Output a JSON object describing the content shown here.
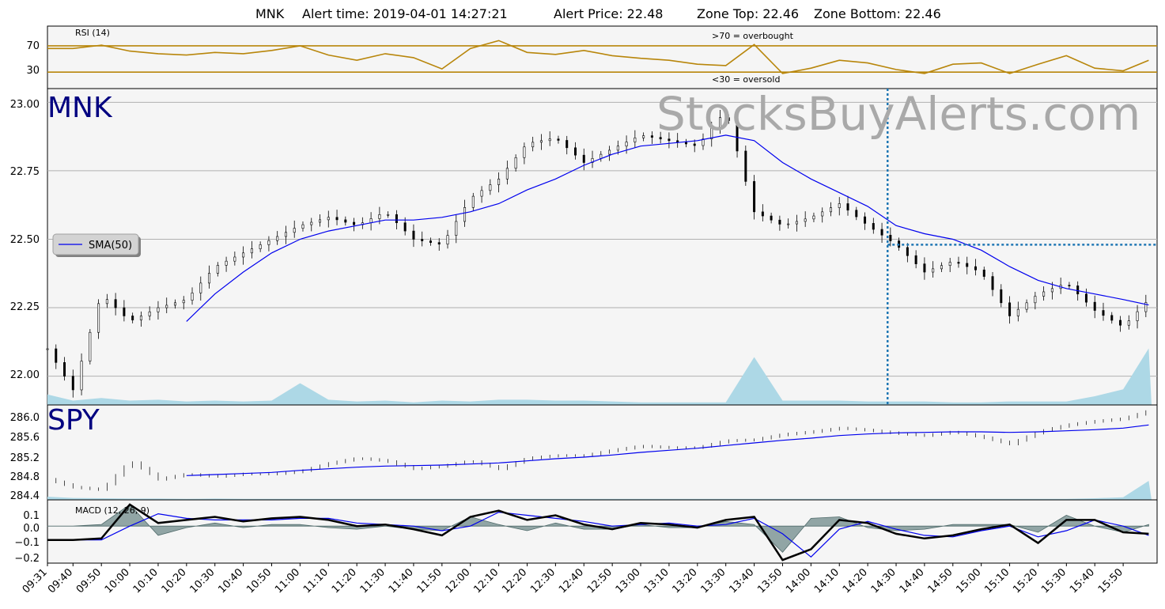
{
  "header": {
    "symbol": "MNK",
    "alert_time_label": "Alert time: 2019-04-01 14:27:21",
    "alert_price_label": "Alert Price: 22.48",
    "zone_top_label": "Zone Top: 22.46",
    "zone_bottom_label": "Zone Bottom: 22.46"
  },
  "watermark": "StocksBuyAlerts.com",
  "colors": {
    "rsi_line": "#b8860b",
    "sma": "#0000ee",
    "volume": "#add8e6",
    "alert_line": "#1f77b4",
    "macd_hist": "#6f8a8a",
    "panel_bg": "#f5f5f5",
    "label_navy": "#000080"
  },
  "chart_data": [
    {
      "type": "line",
      "name": "rsi_panel",
      "title": "RSI (14)",
      "annotations": [
        ">70 = overbought",
        "<30 = oversold"
      ],
      "yticks": [
        "70",
        "30"
      ],
      "ylim": [
        5,
        100
      ],
      "thresholds": [
        70,
        30
      ],
      "x": [
        "09:31",
        "09:40",
        "09:50",
        "10:00",
        "10:10",
        "10:20",
        "10:30",
        "10:40",
        "10:50",
        "11:00",
        "11:10",
        "11:20",
        "11:30",
        "11:40",
        "11:50",
        "12:00",
        "12:10",
        "12:20",
        "12:30",
        "12:40",
        "12:50",
        "13:00",
        "13:10",
        "13:20",
        "13:30",
        "13:40",
        "13:50",
        "14:00",
        "14:10",
        "14:20",
        "14:30",
        "14:40",
        "14:50",
        "15:00",
        "15:10",
        "15:20",
        "15:30",
        "15:40",
        "15:50",
        "15:59"
      ],
      "values": [
        66,
        66,
        71,
        62,
        58,
        56,
        60,
        58,
        63,
        70,
        56,
        48,
        58,
        52,
        35,
        66,
        78,
        60,
        57,
        63,
        55,
        51,
        48,
        42,
        40,
        72,
        28,
        36,
        48,
        44,
        34,
        28,
        42,
        44,
        28,
        42,
        55,
        36,
        32,
        48
      ]
    },
    {
      "type": "candlestick",
      "name": "mnk_price",
      "label": "MNK",
      "legend": "SMA(50)",
      "yticks": [
        "23.00",
        "22.75",
        "22.50",
        "22.25",
        "22.00"
      ],
      "ylim": [
        21.895,
        23.05
      ],
      "alert_time": "14:27",
      "alert_price": 22.48,
      "x": [
        "09:31",
        "09:40",
        "09:50",
        "10:00",
        "10:10",
        "10:20",
        "10:30",
        "10:40",
        "10:50",
        "11:00",
        "11:10",
        "11:20",
        "11:30",
        "11:40",
        "11:50",
        "12:00",
        "12:10",
        "12:20",
        "12:30",
        "12:40",
        "12:50",
        "13:00",
        "13:10",
        "13:20",
        "13:30",
        "13:40",
        "13:50",
        "14:00",
        "14:10",
        "14:20",
        "14:30",
        "14:40",
        "14:50",
        "15:00",
        "15:10",
        "15:20",
        "15:30",
        "15:40",
        "15:50",
        "15:59"
      ],
      "close": [
        22.1,
        21.95,
        22.3,
        22.2,
        22.25,
        22.28,
        22.4,
        22.45,
        22.5,
        22.55,
        22.58,
        22.55,
        22.6,
        22.5,
        22.48,
        22.65,
        22.72,
        22.85,
        22.87,
        22.78,
        22.83,
        22.88,
        22.86,
        22.84,
        22.97,
        22.6,
        22.55,
        22.58,
        22.63,
        22.55,
        22.48,
        22.38,
        22.42,
        22.38,
        22.22,
        22.3,
        22.34,
        22.24,
        22.18,
        22.28
      ],
      "sma": [
        null,
        null,
        null,
        null,
        null,
        22.2,
        22.3,
        22.38,
        22.45,
        22.5,
        22.53,
        22.55,
        22.57,
        22.57,
        22.58,
        22.6,
        22.63,
        22.68,
        22.72,
        22.77,
        22.81,
        22.84,
        22.85,
        22.86,
        22.88,
        22.86,
        22.78,
        22.72,
        22.67,
        22.62,
        22.55,
        22.52,
        22.5,
        22.46,
        22.4,
        22.35,
        22.32,
        22.3,
        22.28,
        22.26
      ],
      "volume": [
        0.12,
        0.05,
        0.08,
        0.05,
        0.06,
        0.04,
        0.05,
        0.04,
        0.05,
        0.25,
        0.06,
        0.04,
        0.05,
        0.03,
        0.05,
        0.04,
        0.06,
        0.06,
        0.05,
        0.05,
        0.04,
        0.03,
        0.03,
        0.03,
        0.03,
        0.55,
        0.05,
        0.05,
        0.05,
        0.04,
        0.04,
        0.04,
        0.03,
        0.03,
        0.04,
        0.04,
        0.04,
        0.1,
        0.18,
        0.65
      ]
    },
    {
      "type": "candlestick",
      "name": "spy_price",
      "label": "SPY",
      "yticks": [
        "286.0",
        "285.6",
        "285.2",
        "284.8",
        "284.4"
      ],
      "ylim": [
        284.36,
        286.16
      ],
      "x": [
        "09:31",
        "09:40",
        "09:50",
        "10:00",
        "10:10",
        "10:20",
        "10:30",
        "10:40",
        "10:50",
        "11:00",
        "11:10",
        "11:20",
        "11:30",
        "11:40",
        "11:50",
        "12:00",
        "12:10",
        "12:20",
        "12:30",
        "12:40",
        "12:50",
        "13:00",
        "13:10",
        "13:20",
        "13:30",
        "13:40",
        "13:50",
        "14:00",
        "14:10",
        "14:20",
        "14:30",
        "14:40",
        "14:50",
        "15:00",
        "15:10",
        "15:20",
        "15:30",
        "15:40",
        "15:50",
        "15:59"
      ],
      "close": [
        284.75,
        284.6,
        284.55,
        285.1,
        284.75,
        284.85,
        284.8,
        284.85,
        284.85,
        284.9,
        285.05,
        285.15,
        285.1,
        284.95,
        285.0,
        285.1,
        284.95,
        285.15,
        285.2,
        285.2,
        285.3,
        285.38,
        285.35,
        285.35,
        285.48,
        285.5,
        285.6,
        285.65,
        285.72,
        285.68,
        285.62,
        285.58,
        285.65,
        285.55,
        285.42,
        285.65,
        285.78,
        285.85,
        285.9,
        286.05
      ],
      "sma": [
        null,
        null,
        null,
        null,
        null,
        284.82,
        284.84,
        284.86,
        284.88,
        284.92,
        284.95,
        284.98,
        285.0,
        285.01,
        285.02,
        285.04,
        285.06,
        285.1,
        285.14,
        285.17,
        285.21,
        285.26,
        285.3,
        285.34,
        285.39,
        285.44,
        285.49,
        285.53,
        285.58,
        285.61,
        285.63,
        285.64,
        285.65,
        285.65,
        285.64,
        285.65,
        285.67,
        285.69,
        285.72,
        285.78
      ],
      "volume": [
        0.1,
        0.06,
        0.05,
        0.04,
        0.04,
        0.03,
        0.04,
        0.03,
        0.03,
        0.03,
        0.03,
        0.03,
        0.03,
        0.03,
        0.03,
        0.03,
        0.03,
        0.03,
        0.03,
        0.03,
        0.03,
        0.03,
        0.03,
        0.03,
        0.03,
        0.03,
        0.03,
        0.03,
        0.03,
        0.03,
        0.03,
        0.03,
        0.03,
        0.03,
        0.03,
        0.03,
        0.03,
        0.05,
        0.08,
        0.6
      ]
    },
    {
      "type": "line",
      "name": "macd_panel",
      "title": "MACD (12, 26, 9)",
      "yticks": [
        "0.1",
        "0.0",
        "−0.1",
        "−0.2"
      ],
      "ylim": [
        -0.24,
        0.17
      ],
      "x": [
        "09:31",
        "09:40",
        "09:50",
        "10:00",
        "10:10",
        "10:20",
        "10:30",
        "10:40",
        "10:50",
        "11:00",
        "11:10",
        "11:20",
        "11:30",
        "11:40",
        "11:50",
        "12:00",
        "12:10",
        "12:20",
        "12:30",
        "12:40",
        "12:50",
        "13:00",
        "13:10",
        "13:20",
        "13:30",
        "13:40",
        "13:50",
        "14:00",
        "14:10",
        "14:20",
        "14:30",
        "14:40",
        "14:50",
        "15:00",
        "15:10",
        "15:20",
        "15:30",
        "15:40",
        "15:50",
        "15:59"
      ],
      "macd": [
        -0.09,
        -0.09,
        -0.08,
        0.14,
        0.02,
        0.04,
        0.06,
        0.03,
        0.05,
        0.06,
        0.04,
        0.0,
        0.01,
        -0.02,
        -0.06,
        0.06,
        0.1,
        0.04,
        0.07,
        0.01,
        -0.02,
        0.02,
        0.01,
        -0.01,
        0.04,
        0.06,
        -0.22,
        -0.15,
        0.04,
        0.02,
        -0.05,
        -0.08,
        -0.06,
        -0.02,
        0.01,
        -0.11,
        0.04,
        0.04,
        -0.04,
        -0.05
      ],
      "signal": [
        -0.09,
        -0.09,
        -0.09,
        0.0,
        0.08,
        0.05,
        0.04,
        0.04,
        0.04,
        0.05,
        0.05,
        0.02,
        0.01,
        0.0,
        -0.03,
        0.0,
        0.09,
        0.07,
        0.05,
        0.03,
        0.0,
        0.01,
        0.02,
        0.0,
        0.01,
        0.05,
        -0.05,
        -0.2,
        -0.02,
        0.03,
        -0.02,
        -0.06,
        -0.07,
        -0.03,
        0.0,
        -0.07,
        -0.03,
        0.04,
        0.0,
        -0.06
      ]
    }
  ],
  "x_axis": {
    "ticks": [
      "09:31",
      "09:40",
      "09:50",
      "10:00",
      "10:10",
      "10:20",
      "10:30",
      "10:40",
      "10:50",
      "11:00",
      "11:10",
      "11:20",
      "11:30",
      "11:40",
      "11:50",
      "12:00",
      "12:10",
      "12:20",
      "12:30",
      "12:40",
      "12:50",
      "13:00",
      "13:10",
      "13:20",
      "13:30",
      "13:40",
      "13:50",
      "14:00",
      "14:10",
      "14:20",
      "14:30",
      "14:40",
      "14:50",
      "15:00",
      "15:10",
      "15:20",
      "15:30",
      "15:40",
      "15:50"
    ]
  }
}
